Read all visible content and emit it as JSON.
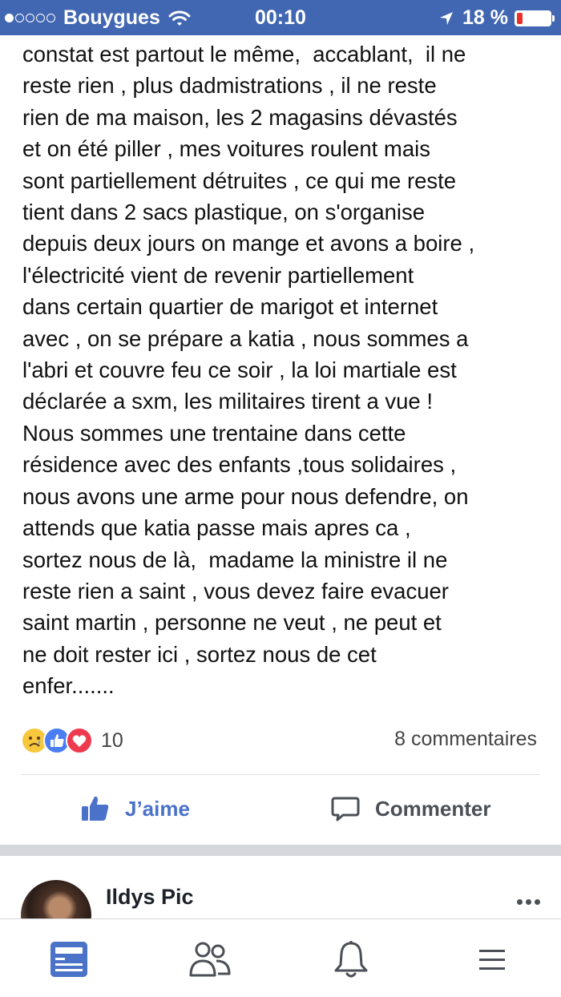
{
  "status_bar": {
    "carrier": "Bouygues",
    "time": "00:10",
    "battery_text": "18 %",
    "battery_level_percent": 18,
    "signal_bars_filled": 1,
    "signal_bars_total": 5,
    "icons": [
      "signal-dots",
      "wifi-icon",
      "location-arrow-icon",
      "battery-icon"
    ]
  },
  "post": {
    "text_lines": [
      "constat est partout le même,  accablant,  il ne",
      "reste rien , plus dadmistrations , il ne reste",
      "rien de ma maison, les 2 magasins dévastés",
      "et on été piller , mes voitures roulent mais",
      "sont partiellement détruites , ce qui me reste",
      "tient dans 2 sacs plastique, on s'organise",
      "depuis deux jours on mange et avons a boire ,",
      "l'électricité vient de revenir partiellement",
      "dans certain quartier de marigot et internet",
      "avec , on se prépare a katia , nous sommes a",
      "l'abri et couvre feu ce soir , la loi martiale est",
      "déclarée a sxm, les militaires tirent a vue !",
      "Nous sommes une trentaine dans cette",
      "résidence avec des enfants ,tous solidaires ,",
      "nous avons une arme pour nous defendre, on",
      "attends que katia passe mais apres ca ,",
      "sortez nous de là,  madame la ministre il ne",
      "reste rien a saint , vous devez faire evacuer",
      "saint martin , personne ne veut , ne peut et",
      "ne doit rester ici , sortez nous de cet",
      "enfer......."
    ],
    "reaction_count": "10",
    "reaction_types": [
      "sad-reaction-icon",
      "like-reaction-icon",
      "love-reaction-icon"
    ],
    "comments_label": "8 commentaires",
    "actions": {
      "like_label": "J’aime",
      "comment_label": "Commenter"
    }
  },
  "next_post": {
    "author": "Ildys Pic"
  },
  "tab_bar": {
    "tabs": [
      "news-feed-icon",
      "friends-icon",
      "notifications-bell-icon",
      "menu-icon"
    ],
    "active_tab": "news-feed-icon"
  },
  "colors": {
    "brand_blue": "#4267b2",
    "like_blue": "#4a72c8",
    "battery_low_red": "#e8302d",
    "separator_gray": "#d5d7dc"
  }
}
